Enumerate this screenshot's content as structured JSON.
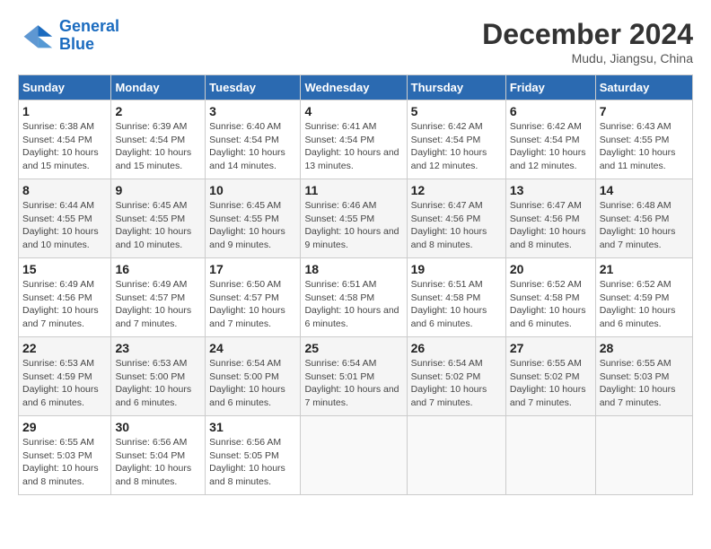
{
  "header": {
    "logo_line1": "General",
    "logo_line2": "Blue",
    "month": "December 2024",
    "location": "Mudu, Jiangsu, China"
  },
  "weekdays": [
    "Sunday",
    "Monday",
    "Tuesday",
    "Wednesday",
    "Thursday",
    "Friday",
    "Saturday"
  ],
  "weeks": [
    [
      {
        "day": 1,
        "sunrise": "6:38 AM",
        "sunset": "4:54 PM",
        "daylight": "10 hours and 15 minutes."
      },
      {
        "day": 2,
        "sunrise": "6:39 AM",
        "sunset": "4:54 PM",
        "daylight": "10 hours and 15 minutes."
      },
      {
        "day": 3,
        "sunrise": "6:40 AM",
        "sunset": "4:54 PM",
        "daylight": "10 hours and 14 minutes."
      },
      {
        "day": 4,
        "sunrise": "6:41 AM",
        "sunset": "4:54 PM",
        "daylight": "10 hours and 13 minutes."
      },
      {
        "day": 5,
        "sunrise": "6:42 AM",
        "sunset": "4:54 PM",
        "daylight": "10 hours and 12 minutes."
      },
      {
        "day": 6,
        "sunrise": "6:42 AM",
        "sunset": "4:54 PM",
        "daylight": "10 hours and 12 minutes."
      },
      {
        "day": 7,
        "sunrise": "6:43 AM",
        "sunset": "4:55 PM",
        "daylight": "10 hours and 11 minutes."
      }
    ],
    [
      {
        "day": 8,
        "sunrise": "6:44 AM",
        "sunset": "4:55 PM",
        "daylight": "10 hours and 10 minutes."
      },
      {
        "day": 9,
        "sunrise": "6:45 AM",
        "sunset": "4:55 PM",
        "daylight": "10 hours and 10 minutes."
      },
      {
        "day": 10,
        "sunrise": "6:45 AM",
        "sunset": "4:55 PM",
        "daylight": "10 hours and 9 minutes."
      },
      {
        "day": 11,
        "sunrise": "6:46 AM",
        "sunset": "4:55 PM",
        "daylight": "10 hours and 9 minutes."
      },
      {
        "day": 12,
        "sunrise": "6:47 AM",
        "sunset": "4:56 PM",
        "daylight": "10 hours and 8 minutes."
      },
      {
        "day": 13,
        "sunrise": "6:47 AM",
        "sunset": "4:56 PM",
        "daylight": "10 hours and 8 minutes."
      },
      {
        "day": 14,
        "sunrise": "6:48 AM",
        "sunset": "4:56 PM",
        "daylight": "10 hours and 7 minutes."
      }
    ],
    [
      {
        "day": 15,
        "sunrise": "6:49 AM",
        "sunset": "4:56 PM",
        "daylight": "10 hours and 7 minutes."
      },
      {
        "day": 16,
        "sunrise": "6:49 AM",
        "sunset": "4:57 PM",
        "daylight": "10 hours and 7 minutes."
      },
      {
        "day": 17,
        "sunrise": "6:50 AM",
        "sunset": "4:57 PM",
        "daylight": "10 hours and 7 minutes."
      },
      {
        "day": 18,
        "sunrise": "6:51 AM",
        "sunset": "4:58 PM",
        "daylight": "10 hours and 6 minutes."
      },
      {
        "day": 19,
        "sunrise": "6:51 AM",
        "sunset": "4:58 PM",
        "daylight": "10 hours and 6 minutes."
      },
      {
        "day": 20,
        "sunrise": "6:52 AM",
        "sunset": "4:58 PM",
        "daylight": "10 hours and 6 minutes."
      },
      {
        "day": 21,
        "sunrise": "6:52 AM",
        "sunset": "4:59 PM",
        "daylight": "10 hours and 6 minutes."
      }
    ],
    [
      {
        "day": 22,
        "sunrise": "6:53 AM",
        "sunset": "4:59 PM",
        "daylight": "10 hours and 6 minutes."
      },
      {
        "day": 23,
        "sunrise": "6:53 AM",
        "sunset": "5:00 PM",
        "daylight": "10 hours and 6 minutes."
      },
      {
        "day": 24,
        "sunrise": "6:54 AM",
        "sunset": "5:00 PM",
        "daylight": "10 hours and 6 minutes."
      },
      {
        "day": 25,
        "sunrise": "6:54 AM",
        "sunset": "5:01 PM",
        "daylight": "10 hours and 7 minutes."
      },
      {
        "day": 26,
        "sunrise": "6:54 AM",
        "sunset": "5:02 PM",
        "daylight": "10 hours and 7 minutes."
      },
      {
        "day": 27,
        "sunrise": "6:55 AM",
        "sunset": "5:02 PM",
        "daylight": "10 hours and 7 minutes."
      },
      {
        "day": 28,
        "sunrise": "6:55 AM",
        "sunset": "5:03 PM",
        "daylight": "10 hours and 7 minutes."
      }
    ],
    [
      {
        "day": 29,
        "sunrise": "6:55 AM",
        "sunset": "5:03 PM",
        "daylight": "10 hours and 8 minutes."
      },
      {
        "day": 30,
        "sunrise": "6:56 AM",
        "sunset": "5:04 PM",
        "daylight": "10 hours and 8 minutes."
      },
      {
        "day": 31,
        "sunrise": "6:56 AM",
        "sunset": "5:05 PM",
        "daylight": "10 hours and 8 minutes."
      },
      null,
      null,
      null,
      null
    ]
  ]
}
